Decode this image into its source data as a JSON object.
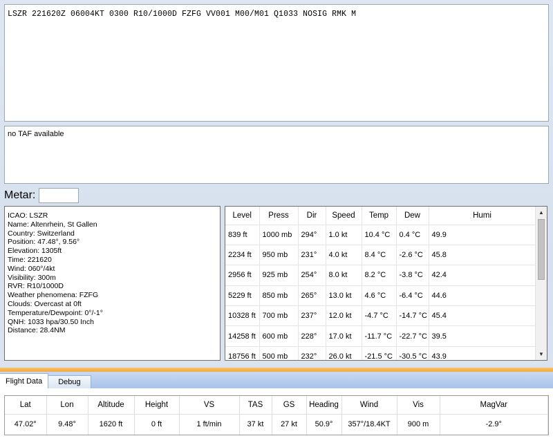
{
  "metar_text": "LSZR 221620Z 06004KT 0300 R10/1000D FZFG VV001 M00/M01 Q1033 NOSIG RMK M",
  "taf_text": "no TAF available",
  "metar_field": {
    "label": "Metar:",
    "value": ""
  },
  "station_info": [
    "ICAO: LSZR",
    "Name: Altenrhein, St Gallen",
    "Country: Switzerland",
    "Position: 47.48°, 9.56°",
    "Elevation: 1305ft",
    "Time: 221620",
    "Wind: 060°/4kt",
    "Visibility: 300m",
    "RVR: R10/1000D",
    "Weather phenomena: FZFG",
    "Clouds: Overcast at 0ft",
    "Temperature/Dewpoint: 0°/-1°",
    "QNH: 1033 hpa/30.50 Inch",
    "Distance: 28.4NM"
  ],
  "winds_aloft": {
    "headers": [
      "Level",
      "Press",
      "Dir",
      "Speed",
      "Temp",
      "Dew",
      "Humi"
    ],
    "rows": [
      [
        "839 ft",
        "1000 mb",
        "294°",
        "1.0 kt",
        "10.4 °C",
        "0.4 °C",
        "49.9"
      ],
      [
        "2234 ft",
        "950 mb",
        "231°",
        "4.0 kt",
        "8.4 °C",
        "-2.6 °C",
        "45.8"
      ],
      [
        "2956 ft",
        "925 mb",
        "254°",
        "8.0 kt",
        "8.2 °C",
        "-3.8 °C",
        "42.4"
      ],
      [
        "5229 ft",
        "850 mb",
        "265°",
        "13.0 kt",
        "4.6 °C",
        "-6.4 °C",
        "44.6"
      ],
      [
        "10328 ft",
        "700 mb",
        "237°",
        "12.0 kt",
        "-4.7 °C",
        "-14.7 °C",
        "45.4"
      ],
      [
        "14258 ft",
        "600 mb",
        "228°",
        "17.0 kt",
        "-11.7 °C",
        "-22.7 °C",
        "39.5"
      ],
      [
        "18756 ft",
        "500 mb",
        "232°",
        "26.0 kt",
        "-21.5 °C",
        "-30.5 °C",
        "43.9"
      ]
    ]
  },
  "tabs": [
    {
      "label": "Flight Data",
      "active": true
    },
    {
      "label": "Debug",
      "active": false
    }
  ],
  "flight_data": {
    "headers": [
      "Lat",
      "Lon",
      "Altitude",
      "Height",
      "VS",
      "TAS",
      "GS",
      "Heading",
      "Wind",
      "Vis",
      "MagVar"
    ],
    "values": [
      "47.02°",
      "9.48°",
      "1620 ft",
      "0 ft",
      "1 ft/min",
      "37 kt",
      "27 kt",
      "50.9°",
      "357°/18.4KT",
      "900 m",
      "-2.9°"
    ]
  },
  "colors": {
    "accent_divider": "#f4a93c",
    "tab_strip": "#b9cfee"
  }
}
